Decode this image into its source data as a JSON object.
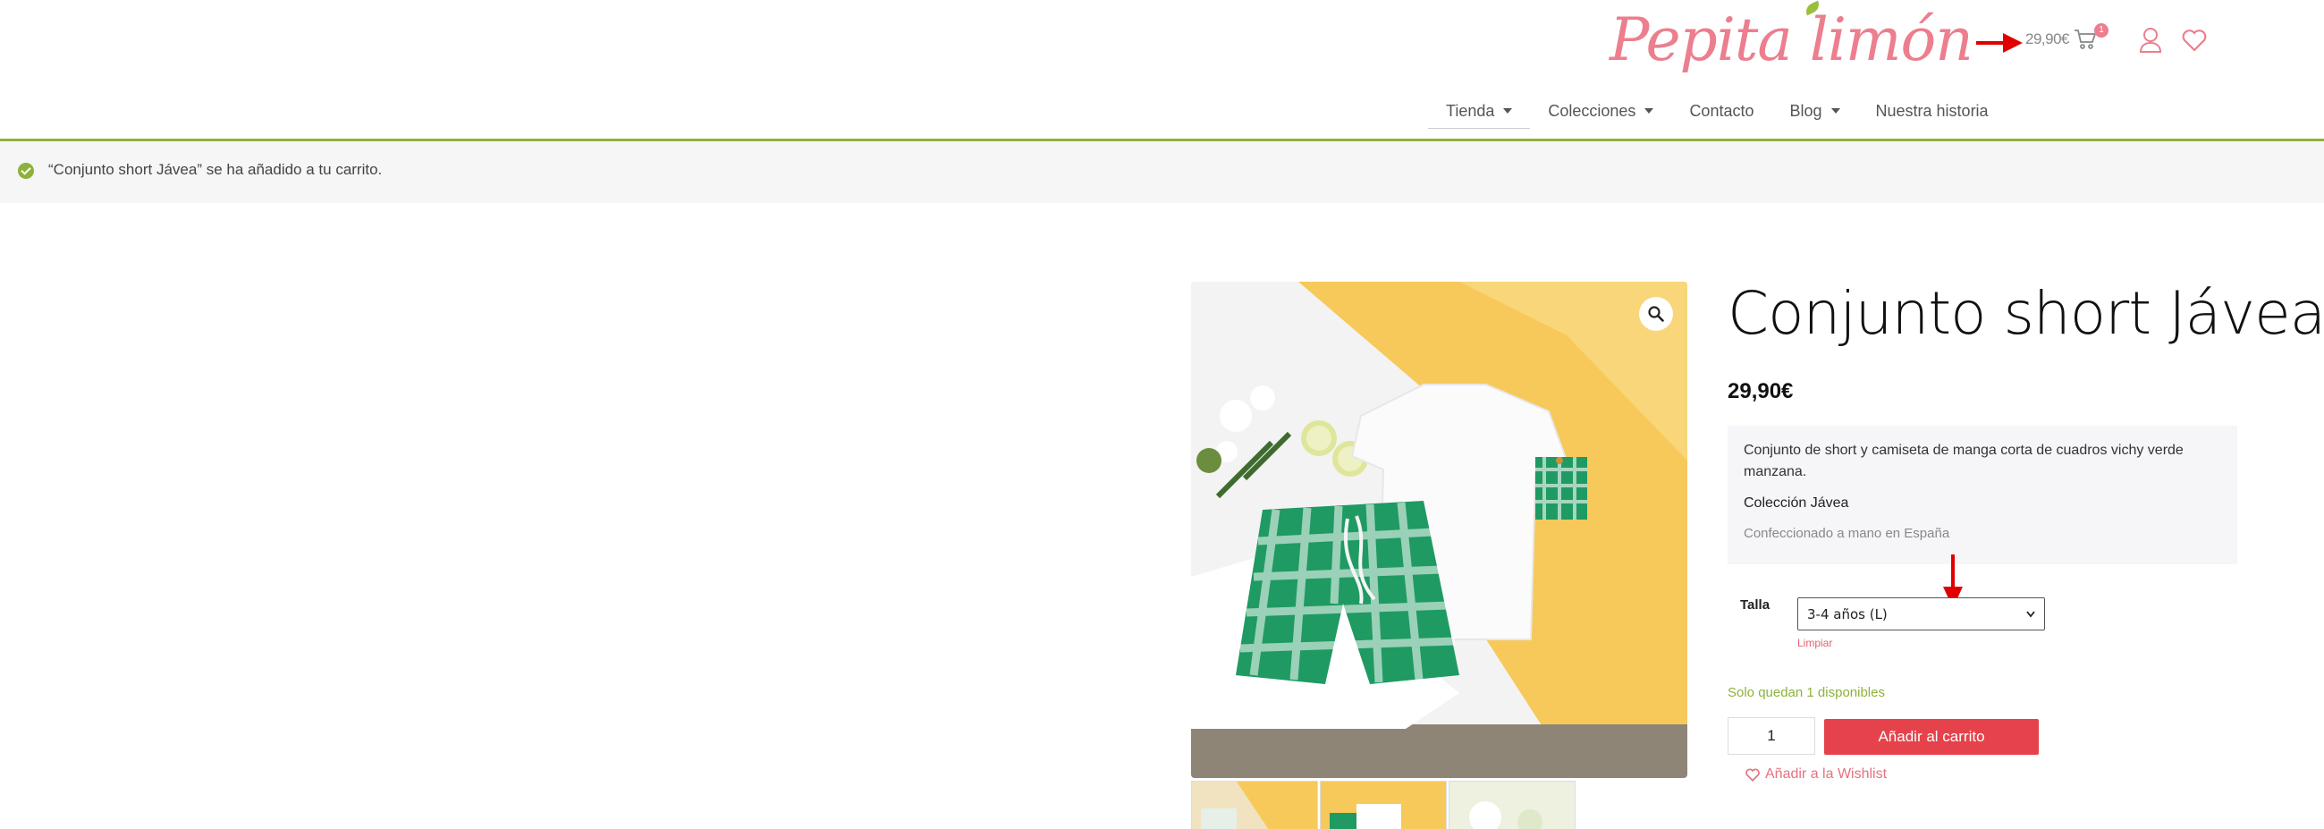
{
  "header": {
    "logo_text": "Pepita limón",
    "cart_total": "29,90€",
    "cart_count": "1"
  },
  "nav": {
    "items": [
      {
        "label": "Tienda",
        "has_caret": true
      },
      {
        "label": "Colecciones",
        "has_caret": true
      },
      {
        "label": "Contacto",
        "has_caret": false
      },
      {
        "label": "Blog",
        "has_caret": true
      },
      {
        "label": "Nuestra historia",
        "has_caret": false
      }
    ]
  },
  "notice": {
    "text": "“Conjunto short Jávea” se ha añadido a tu carrito."
  },
  "product": {
    "title": "Conjunto short Jávea",
    "price": "29,90€",
    "description": "Conjunto de short y camiseta de manga corta de cuadros vichy verde manzana.",
    "collection": "Colección Jávea",
    "made_in": "Confeccionado a mano en España",
    "size_label": "Talla",
    "size_selected": "3-4 años (L)",
    "clear_label": "Limpiar",
    "stock_text": "Solo quedan 1 disponibles",
    "quantity": "1",
    "add_to_cart": "Añadir al carrito",
    "wishlist": "Añadir a la Wishlist"
  },
  "colors": {
    "brand_pink": "#ec7e8e",
    "accent_green": "#8eb13b",
    "button_red": "#e5424b",
    "annotation_red": "#e00000"
  }
}
